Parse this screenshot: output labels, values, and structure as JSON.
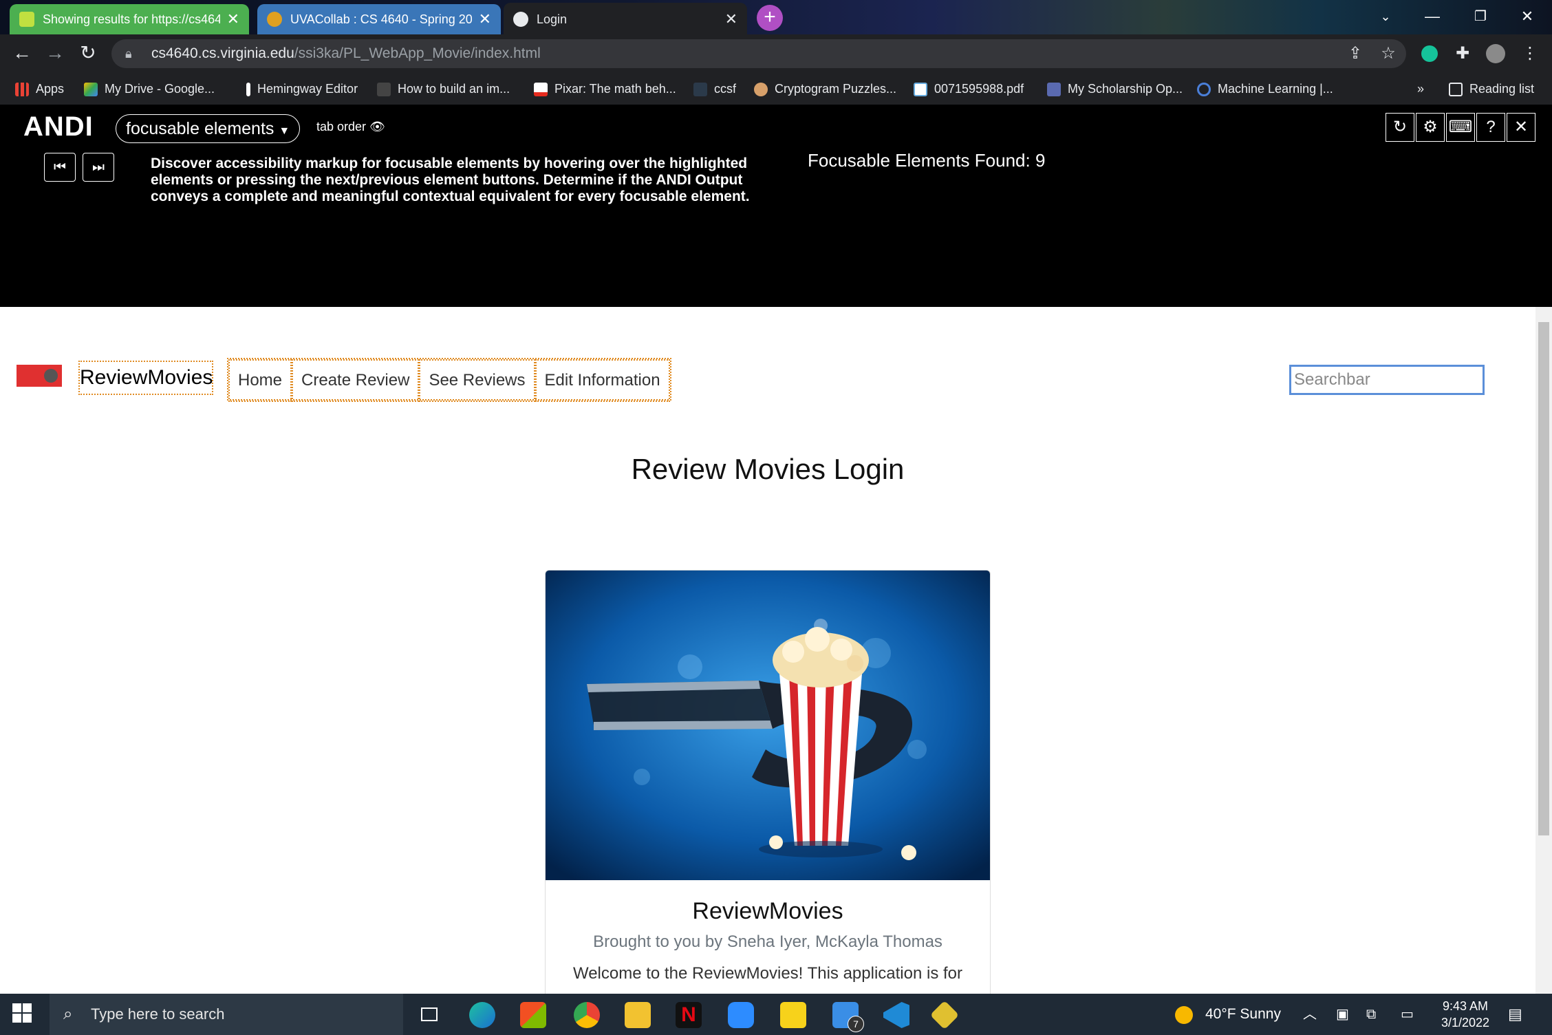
{
  "browser": {
    "tabs": [
      {
        "title": "Showing results for https://cs464",
        "favicon_color": "#c0e040"
      },
      {
        "title": "UVACollab : CS 4640 - Spring 20",
        "favicon_color": "#e0a020"
      },
      {
        "title": "Login",
        "favicon_color": "#e8eaed"
      }
    ],
    "new_tab_symbol": "+",
    "url_host": "cs4640.cs.virginia.edu",
    "url_path": "/ssi3ka/PL_WebApp_Movie/index.html",
    "bookmarks": [
      {
        "label": "Apps"
      },
      {
        "label": "My Drive - Google..."
      },
      {
        "label": "Hemingway Editor"
      },
      {
        "label": "How to build an im..."
      },
      {
        "label": "Pixar: The math beh..."
      },
      {
        "label": "ccsf"
      },
      {
        "label": "Cryptogram Puzzles..."
      },
      {
        "label": "0071595988.pdf"
      },
      {
        "label": "My Scholarship Op..."
      },
      {
        "label": "Machine Learning |..."
      }
    ],
    "bookmarks_overflow": "»",
    "reading_list": "Reading list"
  },
  "andi": {
    "logo": "ANDI",
    "mode": "focusable elements",
    "tab_order": "tab order",
    "description": "Discover accessibility markup for focusable elements by hovering over the highlighted elements or pressing the next/previous element buttons. Determine if the ANDI Output conveys a complete and meaningful contextual equivalent for every focusable element.",
    "found": "Focusable Elements Found: 9"
  },
  "site": {
    "brand": "ReviewMovies",
    "nav": [
      "Home",
      "Create Review",
      "See Reviews",
      "Edit Information"
    ],
    "search_placeholder": "Searchbar",
    "page_title": "Review Movies Login",
    "card_title": "ReviewMovies",
    "card_subtitle": "Brought to you by Sneha Iyer, McKayla Thomas",
    "card_text": "Welcome to the ReviewMovies! This application is for"
  },
  "taskbar": {
    "search_placeholder": "Type here to search",
    "weather": "40°F  Sunny",
    "time": "9:43 AM",
    "date": "3/1/2022",
    "badge": "7"
  }
}
